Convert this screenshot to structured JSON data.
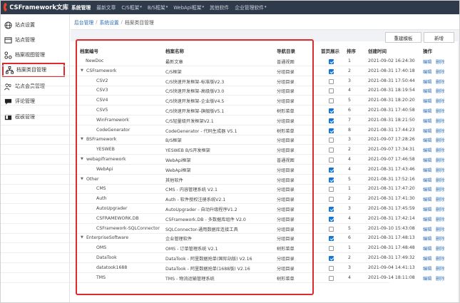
{
  "app": {
    "logo_text": "CSFramework文库"
  },
  "topnav": [
    {
      "label": "系统管理",
      "active": true,
      "caret": false
    },
    {
      "label": "最新文章",
      "active": false,
      "caret": false
    },
    {
      "label": "C/S框架",
      "active": false,
      "caret": true
    },
    {
      "label": "B/S框架",
      "active": false,
      "caret": true
    },
    {
      "label": "WebApi框架",
      "active": false,
      "caret": true
    },
    {
      "label": "其他软件",
      "active": false,
      "caret": false
    },
    {
      "label": "企业管理软件",
      "active": false,
      "caret": true
    }
  ],
  "sidebar": [
    {
      "label": "站点设置",
      "icon": "globe-icon",
      "active": false
    },
    {
      "label": "站点管理",
      "icon": "site-icon",
      "active": false
    },
    {
      "label": "档案视图管理",
      "icon": "tree-icon",
      "active": false
    },
    {
      "label": "档案类目管理",
      "icon": "org-icon",
      "active": true
    },
    {
      "label": "站点会员管理",
      "icon": "users-icon",
      "active": false
    },
    {
      "label": "评论管理",
      "icon": "comment-icon",
      "active": false
    },
    {
      "label": "模板管理",
      "icon": "template-icon",
      "active": false
    }
  ],
  "breadcrumb": {
    "items": [
      "后台管理",
      "系统设置"
    ],
    "current": "档案类目管理",
    "sep": "/"
  },
  "toolbar": {
    "template_btn": "重建模板",
    "add_btn": "新增"
  },
  "table": {
    "headers": {
      "code": "档案编号",
      "name": "档案名称",
      "nav": "导航目录",
      "home": "首页展示",
      "sort": "排序",
      "created": "创建时间",
      "ops": "操作"
    },
    "edit_label": "编辑",
    "delete_label": "删除",
    "rows": [
      {
        "level": 0,
        "toggle": false,
        "code": "NewDoc",
        "name": "最新文章",
        "nav": "普通视图",
        "home": true,
        "sort": "1",
        "created": "2021-09-02 16:24:30"
      },
      {
        "level": 0,
        "toggle": true,
        "code": "CSFramework",
        "name": "C/S框架",
        "nav": "分组目录",
        "home": true,
        "sort": "2",
        "created": "2021-08-31 17:40:18"
      },
      {
        "level": 1,
        "toggle": false,
        "code": "CSV2",
        "name": "C/S快速开发框架-标准版V2.3",
        "nav": "分组目录",
        "home": false,
        "sort": "3",
        "created": "2021-08-31 17:50:44"
      },
      {
        "level": 1,
        "toggle": false,
        "code": "CSV3",
        "name": "C/S快速开发框架-高级版V3.0",
        "nav": "分组目录",
        "home": false,
        "sort": "4",
        "created": "2021-08-31 18:19:54"
      },
      {
        "level": 1,
        "toggle": false,
        "code": "CSV4",
        "name": "C/S快速开发框架-企业版V4.5",
        "nav": "分组目录",
        "home": false,
        "sort": "5",
        "created": "2021-08-31 18:20:20"
      },
      {
        "level": 1,
        "toggle": false,
        "code": "CSV5",
        "name": "C/S快速开发框架-旗舰版V5.1",
        "nav": "树形菜单",
        "home": true,
        "sort": "6",
        "created": "2021-08-31 17:40:58"
      },
      {
        "level": 1,
        "toggle": false,
        "code": "WinFramework",
        "name": "C/S轻量级开发框架V2.1",
        "nav": "分组目录",
        "home": true,
        "sort": "7",
        "created": "2021-08-31 18:21:50"
      },
      {
        "level": 1,
        "toggle": false,
        "code": "CodeGenerator",
        "name": "CodeGenerator - 代码生成器 V5.1",
        "nav": "树形菜单",
        "home": true,
        "sort": "8",
        "created": "2021-08-31 17:44:23"
      },
      {
        "level": 0,
        "toggle": true,
        "code": "BSFramework",
        "name": "B/S框架",
        "nav": "分组目录",
        "home": false,
        "sort": "3",
        "created": "2021-09-07 17:28:26"
      },
      {
        "level": 1,
        "toggle": false,
        "code": "YESWEB",
        "name": "YESWEB B/S开发框架",
        "nav": "分组目录",
        "home": false,
        "sort": "2",
        "created": "2021-09-07 17:34:31"
      },
      {
        "level": 0,
        "toggle": true,
        "code": "webapiframework",
        "name": "WebApi框架",
        "nav": "普通视图",
        "home": false,
        "sort": "4",
        "created": "2021-09-07 17:46:58"
      },
      {
        "level": 1,
        "toggle": false,
        "code": "WebApi",
        "name": "WebApi框架",
        "nav": "分组目录",
        "home": true,
        "sort": "4",
        "created": "2021-08-31 17:43:46"
      },
      {
        "level": 0,
        "toggle": true,
        "code": "Other",
        "name": "其他软件",
        "nav": "分组目录",
        "home": true,
        "sort": "5",
        "created": "2021-08-31 17:52:16"
      },
      {
        "level": 1,
        "toggle": false,
        "code": "CMS",
        "name": "CMS - 内容管理系统 V2.1",
        "nav": "分组目录",
        "home": false,
        "sort": "1",
        "created": "2021-08-31 17:47:20"
      },
      {
        "level": 1,
        "toggle": false,
        "code": "Auth",
        "name": "Auth - 软件授权注册系统V2.1",
        "nav": "分组目录",
        "home": false,
        "sort": "2",
        "created": "2021-08-31 17:41:30"
      },
      {
        "level": 1,
        "toggle": false,
        "code": "AutoUpgrader",
        "name": "AutoUpgrader - 自动升级程序V1.2",
        "nav": "分组目录",
        "home": true,
        "sort": "3",
        "created": "2021-08-31 17:45:59"
      },
      {
        "level": 1,
        "toggle": false,
        "code": "CSFRAMEWORK.DB",
        "name": "CSFramework.DB - 多数据库组件 V2.0",
        "nav": "分组目录",
        "home": true,
        "sort": "4",
        "created": "2021-08-31 17:42:14"
      },
      {
        "level": 1,
        "toggle": false,
        "code": "CSFramework-SQLConnector",
        "name": "SQLConnector-通用数据库连接工具",
        "nav": "分组目录",
        "home": false,
        "sort": "5",
        "created": "2021-09-10 15:43:08"
      },
      {
        "level": 0,
        "toggle": true,
        "code": "EnterpriseSoftware",
        "name": "企业管理软件",
        "nav": "分组目录",
        "home": true,
        "sort": "6",
        "created": "2021-08-31 17:48:13"
      },
      {
        "level": 1,
        "toggle": false,
        "code": "OMS",
        "name": "OMS - 订单管理系统 V2.1",
        "nav": "树形菜单",
        "home": false,
        "sort": "1",
        "created": "2021-08-31 17:48:48"
      },
      {
        "level": 1,
        "toggle": false,
        "code": "DataTook",
        "name": "DataTook - 阿里数据抢单(国际站版) V2.16",
        "nav": "分组目录",
        "home": true,
        "sort": "2",
        "created": "2021-08-31 17:49:32"
      },
      {
        "level": 1,
        "toggle": false,
        "code": "datatook1688",
        "name": "DataTook - 阿里数据抢单(1688版) V2.16",
        "nav": "分组目录",
        "home": false,
        "sort": "3",
        "created": "2021-09-04 14:41:13"
      },
      {
        "level": 1,
        "toggle": false,
        "code": "TMS",
        "name": "TMS - 物流运输管理系统",
        "nav": "树形菜单",
        "home": false,
        "sort": "4",
        "created": "2021-09-14 18:11:08"
      }
    ]
  }
}
